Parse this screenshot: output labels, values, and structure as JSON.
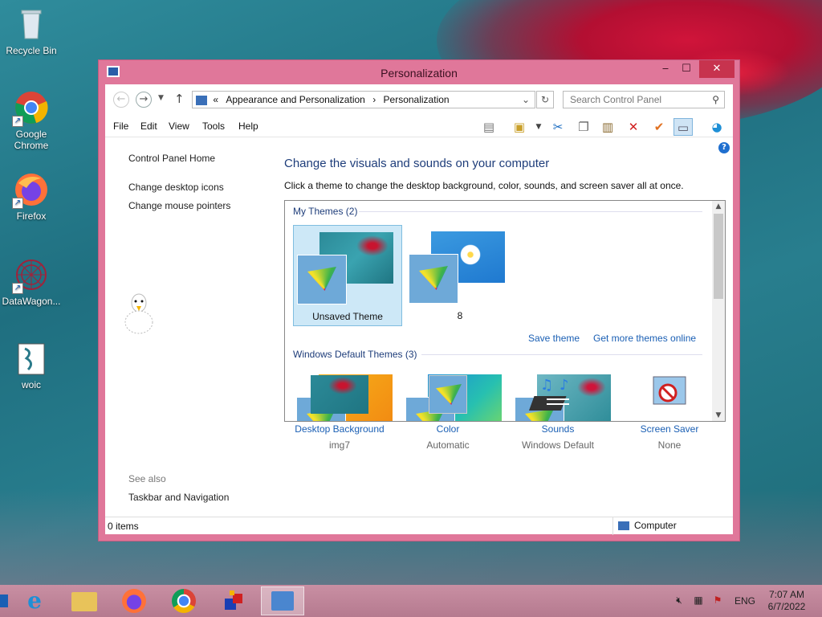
{
  "desktop": {
    "icons": [
      {
        "label": "Recycle Bin",
        "icon": "recycle-bin-icon"
      },
      {
        "label": "Google Chrome",
        "icon": "chrome-icon"
      },
      {
        "label": "Firefox",
        "icon": "firefox-icon"
      },
      {
        "label": "DataWagon...",
        "icon": "datawagon-icon"
      },
      {
        "label": "woic",
        "icon": "script-icon"
      }
    ]
  },
  "window": {
    "title": "Personalization",
    "controls": {
      "minimize": "‒",
      "maximize": "☐",
      "close": "✕"
    },
    "address": {
      "prefix": "«",
      "crumbs": [
        "Appearance and Personalization",
        "Personalization"
      ],
      "separator": "›"
    },
    "search": {
      "placeholder": "Search Control Panel"
    },
    "menu": [
      "File",
      "Edit",
      "View",
      "Tools",
      "Help"
    ],
    "left_pane": {
      "home": "Control Panel Home",
      "links": [
        "Change desktop icons",
        "Change mouse pointers"
      ],
      "see_also_label": "See also",
      "see_also_links": [
        "Taskbar and Navigation"
      ]
    },
    "main": {
      "heading": "Change the visuals and sounds on your computer",
      "subheading": "Click a theme to change the desktop background, color, sounds, and screen saver all at once.",
      "my_themes_label": "My Themes (2)",
      "my_themes": [
        {
          "name": "Unsaved Theme",
          "selected": true
        },
        {
          "name": "8",
          "selected": false
        }
      ],
      "save_theme": "Save theme",
      "get_more": "Get more themes online",
      "default_themes_label": "Windows Default Themes (3)",
      "quick_settings": [
        {
          "label": "Desktop Background",
          "value": "img7",
          "icon": "desktop-background-icon"
        },
        {
          "label": "Color",
          "value": "Automatic",
          "icon": "color-icon"
        },
        {
          "label": "Sounds",
          "value": "Windows Default",
          "icon": "sounds-icon"
        },
        {
          "label": "Screen Saver",
          "value": "None",
          "icon": "screen-saver-icon"
        }
      ]
    },
    "status": {
      "items": "0 items",
      "location": "Computer"
    }
  },
  "taskbar": {
    "apps": [
      "Internet Explorer",
      "File Explorer",
      "Firefox",
      "Google Chrome",
      "App",
      "Control Panel"
    ],
    "language": "ENG",
    "time": "7:07 AM",
    "date": "6/7/2022"
  }
}
